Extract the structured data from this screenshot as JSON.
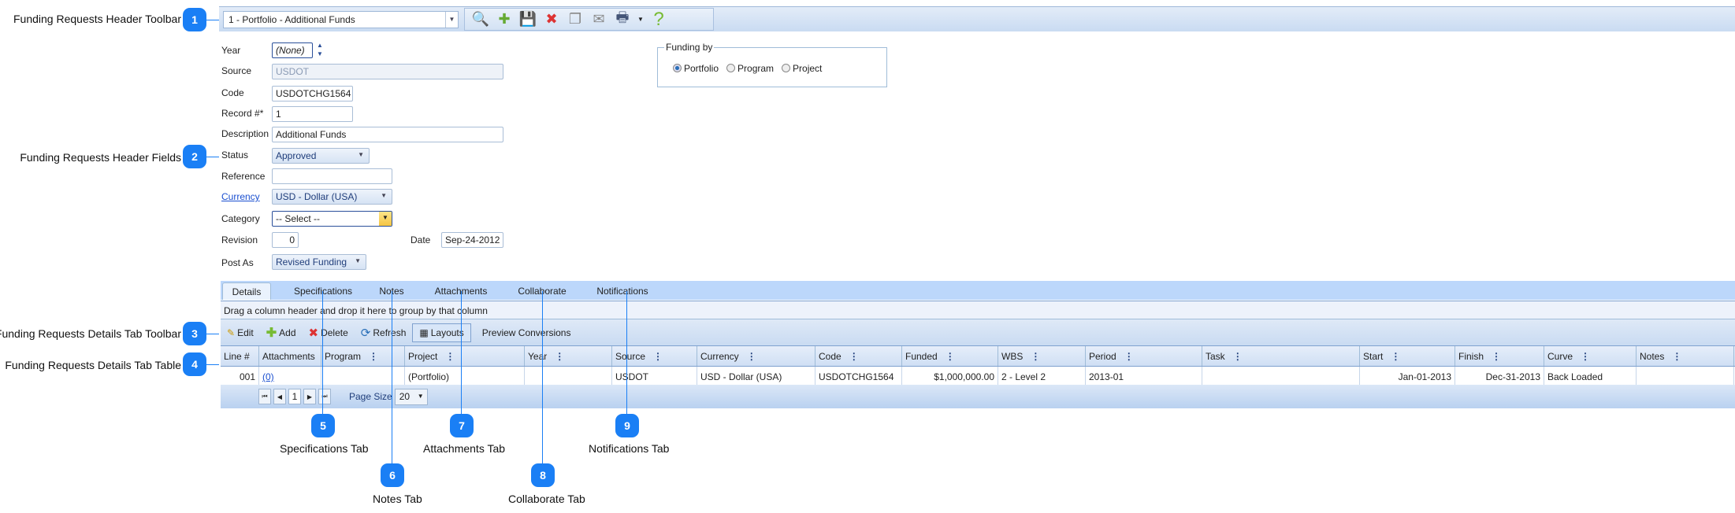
{
  "callouts": [
    {
      "n": "1",
      "label": "Funding Requests Header Toolbar"
    },
    {
      "n": "2",
      "label": "Funding Requests Header Fields"
    },
    {
      "n": "3",
      "label": "Funding Requests Details Tab Toolbar"
    },
    {
      "n": "4",
      "label": "Funding Requests Details Tab Table"
    },
    {
      "n": "5",
      "label": "Specifications Tab"
    },
    {
      "n": "6",
      "label": "Notes Tab"
    },
    {
      "n": "7",
      "label": "Attachments Tab"
    },
    {
      "n": "8",
      "label": "Collaborate Tab"
    },
    {
      "n": "9",
      "label": "Notifications Tab"
    }
  ],
  "toolbar": {
    "record": "1 - Portfolio  - Additional Funds",
    "icons": [
      "search-icon",
      "new-document-icon",
      "save-icon",
      "delete-document-icon",
      "copy-icon",
      "email-icon",
      "print-icon",
      "help-icon"
    ]
  },
  "form": {
    "year": {
      "label": "Year",
      "value": "(None)"
    },
    "source": {
      "label": "Source",
      "value": "USDOT"
    },
    "code": {
      "label": "Code",
      "value": "USDOTCHG1564"
    },
    "record": {
      "label": "Record #*",
      "value": "1"
    },
    "description": {
      "label": "Description",
      "value": "Additional Funds"
    },
    "status": {
      "label": "Status",
      "value": "Approved"
    },
    "reference": {
      "label": "Reference",
      "value": ""
    },
    "currency": {
      "label": "Currency",
      "value": "USD - Dollar (USA)"
    },
    "category": {
      "label": "Category",
      "value": "-- Select --"
    },
    "revision": {
      "label": "Revision",
      "value": "0"
    },
    "date": {
      "label": "Date",
      "value": "Sep-24-2012"
    },
    "post_as": {
      "label": "Post As",
      "value": "Revised Funding"
    }
  },
  "funding_by": {
    "legend": "Funding by",
    "options": [
      "Portfolio",
      "Program",
      "Project"
    ],
    "selected": "Portfolio"
  },
  "tabs": [
    "Details",
    "Specifications",
    "Notes",
    "Attachments",
    "Collaborate",
    "Notifications"
  ],
  "active_tab": "Details",
  "group_hint": "Drag a column header and drop it here to group by that column",
  "grid_toolbar": {
    "edit": "Edit",
    "add": "Add",
    "delete": "Delete",
    "refresh": "Refresh",
    "layouts": "Layouts",
    "preview": "Preview Conversions"
  },
  "columns": [
    "Line #",
    "Attachments",
    "Program",
    "Project",
    "Year",
    "Source",
    "Currency",
    "Code",
    "Funded",
    "WBS",
    "Period",
    "Task",
    "Start",
    "Finish",
    "Curve",
    "Notes"
  ],
  "rows": [
    [
      "001",
      "(0)",
      "",
      "(Portfolio)",
      "",
      "USDOT",
      "USD - Dollar (USA)",
      "USDOTCHG1564",
      "$1,000,000.00",
      "2 - Level 2",
      "2013-01",
      "",
      "Jan-01-2013",
      "Dec-31-2013",
      "Back Loaded",
      ""
    ]
  ],
  "pager": {
    "page": "1",
    "page_size_label": "Page Size",
    "page_size": "20"
  }
}
